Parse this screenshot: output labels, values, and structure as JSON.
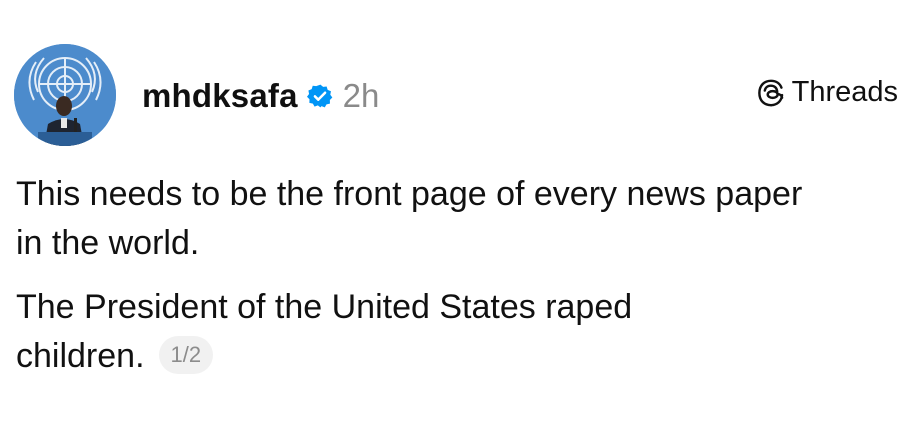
{
  "post": {
    "username": "mhdksafa",
    "timestamp": "2h",
    "platform_label": "Threads",
    "paragraphs": [
      "This needs to be the front page of every news paper in the world.",
      "The President of the United States raped children."
    ],
    "page_indicator": "1/2"
  },
  "icons": {
    "verified": "verified-badge-icon",
    "platform": "threads-logo-icon"
  },
  "colors": {
    "verified_blue": "#0095f6",
    "timestamp_gray": "#8a8a8a",
    "badge_bg": "#f1f1f1"
  }
}
